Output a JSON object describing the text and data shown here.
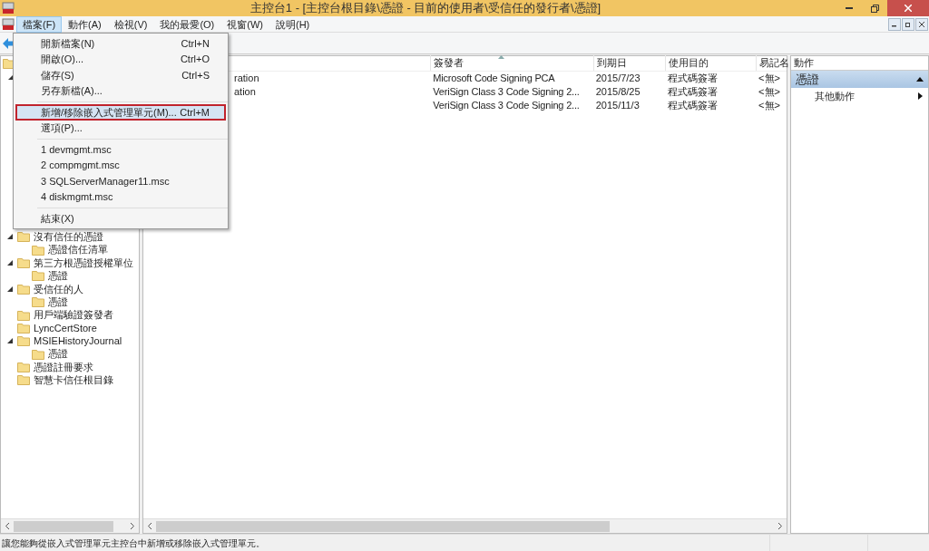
{
  "window": {
    "title": "主控台1 - [主控台根目錄\\憑證 - 目前的使用者\\受信任的發行者\\憑證]"
  },
  "menu_bar": [
    {
      "label": "檔案(F)",
      "selected": true
    },
    {
      "label": "動作(A)",
      "selected": false
    },
    {
      "label": "檢視(V)",
      "selected": false
    },
    {
      "label": "我的最愛(O)",
      "selected": false
    },
    {
      "label": "視窗(W)",
      "selected": false
    },
    {
      "label": "說明(H)",
      "selected": false
    }
  ],
  "file_menu": [
    {
      "kind": "item",
      "label": "開新檔案(N)",
      "shortcut": "Ctrl+N",
      "selected": false
    },
    {
      "kind": "item",
      "label": "開啟(O)...",
      "shortcut": "Ctrl+O",
      "selected": false
    },
    {
      "kind": "item",
      "label": "儲存(S)",
      "shortcut": "Ctrl+S",
      "selected": false
    },
    {
      "kind": "item",
      "label": "另存新檔(A)...",
      "selected": false
    },
    {
      "kind": "separator"
    },
    {
      "kind": "item",
      "label": "新增/移除嵌入式管理單元(M)...",
      "shortcut": "Ctrl+M",
      "selected": true
    },
    {
      "kind": "item",
      "label": "選項(P)...",
      "selected": false
    },
    {
      "kind": "separator"
    },
    {
      "kind": "item",
      "label": "1 devmgmt.msc",
      "selected": false
    },
    {
      "kind": "item",
      "label": "2 compmgmt.msc",
      "selected": false
    },
    {
      "kind": "item",
      "label": "3 SQLServerManager11.msc",
      "selected": false
    },
    {
      "kind": "item",
      "label": "4 diskmgmt.msc",
      "selected": false
    },
    {
      "kind": "separator"
    },
    {
      "kind": "item",
      "label": "結束(X)",
      "selected": false
    }
  ],
  "tree": [
    {
      "label": "沒有信任的憑證",
      "expanded": true,
      "children": [
        {
          "label": "憑證信任清單"
        }
      ]
    },
    {
      "label": "第三方根憑證授權單位",
      "expanded": true,
      "children": [
        {
          "label": "憑證"
        }
      ]
    },
    {
      "label": "受信任的人",
      "expanded": true,
      "children": [
        {
          "label": "憑證"
        }
      ]
    },
    {
      "label": "用戶端驗證簽發者"
    },
    {
      "label": "LyncCertStore"
    },
    {
      "label": "MSIEHistoryJournal",
      "expanded": true,
      "children": [
        {
          "label": "憑證"
        }
      ]
    },
    {
      "label": "憑證註冊要求"
    },
    {
      "label": "智慧卡信任根目錄"
    }
  ],
  "table": {
    "columns": [
      "簽發者",
      "到期日",
      "使用目的",
      "易記名"
    ],
    "rows": [
      {
        "column_1": "ration",
        "issuer": "Microsoft Code Signing PCA",
        "expires": "2015/7/23",
        "purpose": "程式碼簽署",
        "friendly_name": "<無>"
      },
      {
        "column_1": "ation",
        "issuer": "VeriSign Class 3 Code Signing 2...",
        "expires": "2015/8/25",
        "purpose": "程式碼簽署",
        "friendly_name": "<無>"
      },
      {
        "issuer": "VeriSign Class 3 Code Signing 2...",
        "expires": "2015/11/3",
        "purpose": "程式碼簽署",
        "friendly_name": "<無>"
      }
    ]
  },
  "actions": {
    "title": "動作",
    "section": "憑證",
    "items": [
      "其他動作"
    ]
  },
  "status_bar": "讓您能夠從嵌入式管理單元主控台中新增或移除嵌入式管理單元。"
}
